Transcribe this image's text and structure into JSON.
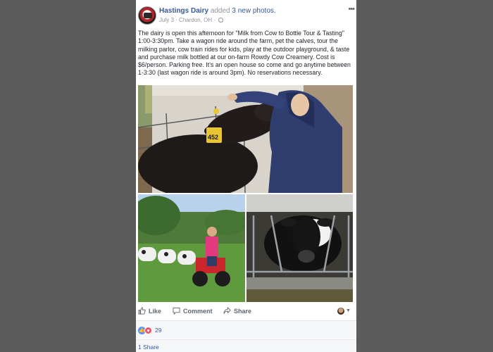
{
  "post": {
    "page_name": "Hastings Dairy",
    "added_text": "added",
    "photos_link": "3 new photos.",
    "date": "July 3",
    "location": "Chardon, OH",
    "meta_separator": "·",
    "more_icon": "more-horizontal-icon",
    "text": "The dairy is open this afternoon for \"Milk from Cow to Bottle Tour & Tasting\" 1:00-3:30pm. Take a wagon ride around the farm, pet the calves, tour the milking parlor, cow train rides for kids, play at the outdoor playground, & taste and purchase milk bottled at our on-farm Rowdy Cow Creamery. Cost is $6/person. Parking free. It's an open house so come and go anytime between 1-3:30 (last wagon ride is around 3pm). No reservations necessary.",
    "calf_tag": "452"
  },
  "actions": {
    "like": "Like",
    "comment": "Comment",
    "share": "Share"
  },
  "reactions": {
    "count": "29",
    "types": [
      "like",
      "love"
    ]
  },
  "shares": {
    "label": "1 Share"
  },
  "colors": {
    "link": "#365899",
    "muted": "#90949c",
    "background": "#5c5c5c",
    "like_blue": "#5890ff",
    "love_red": "#f25268"
  }
}
